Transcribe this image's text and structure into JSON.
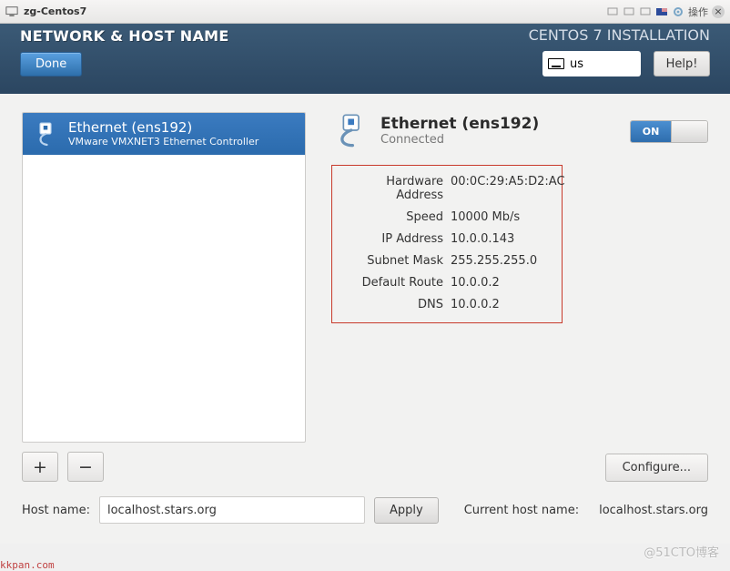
{
  "window_title": "zg-Centos7",
  "tray": {
    "actions_label": "操作"
  },
  "header": {
    "page_title": "NETWORK & HOST NAME",
    "done_label": "Done",
    "install_title": "CENTOS 7 INSTALLATION",
    "keyboard_layout": "us",
    "help_label": "Help!"
  },
  "interfaces": [
    {
      "name": "Ethernet (ens192)",
      "desc": "VMware VMXNET3 Ethernet Controller"
    }
  ],
  "selected_interface": {
    "name": "Ethernet (ens192)",
    "status": "Connected",
    "toggle_on_label": "ON",
    "details": {
      "labels": {
        "hw": "Hardware Address",
        "speed": "Speed",
        "ip": "IP Address",
        "mask": "Subnet Mask",
        "route": "Default Route",
        "dns": "DNS"
      },
      "hw": "00:0C:29:A5:D2:AC",
      "speed": "10000 Mb/s",
      "ip": "10.0.0.143",
      "mask": "255.255.255.0",
      "route": "10.0.0.2",
      "dns": "10.0.0.2"
    },
    "configure_label": "Configure..."
  },
  "buttons": {
    "add": "+",
    "remove": "−",
    "apply": "Apply"
  },
  "hostname": {
    "label": "Host name:",
    "value": "localhost.stars.org",
    "current_label": "Current host name:",
    "current_value": "localhost.stars.org"
  },
  "watermarks": {
    "left": "kkpan.com",
    "right": "@51CTO博客"
  }
}
